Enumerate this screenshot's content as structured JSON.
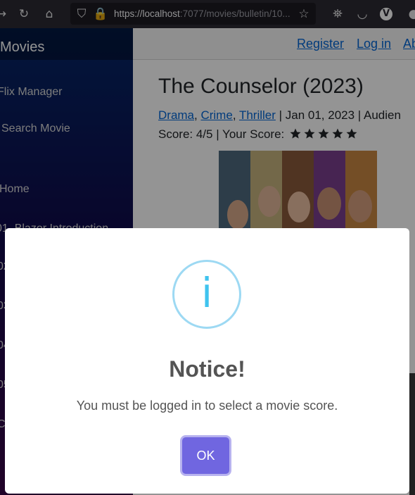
{
  "browser": {
    "url_main": "https://localhost",
    "url_rest": ":7077/movies/bulletin/10..."
  },
  "sidebar": {
    "brand": "Movies",
    "items": [
      {
        "label": "Flix Manager"
      },
      {
        "label": "Search Movie"
      },
      {
        "label": "Home"
      },
      {
        "label": "01. Blazor Introduction"
      },
      {
        "label": "02"
      },
      {
        "label": "03"
      },
      {
        "label": "04"
      },
      {
        "label": "05"
      },
      {
        "label": "C"
      }
    ]
  },
  "topbar": {
    "register": "Register",
    "login": "Log in",
    "about": "Ab"
  },
  "movie": {
    "title": "The Counselor (2023)",
    "genres": [
      "Drama",
      "Crime",
      "Thriller"
    ],
    "date_text": " | Jan 01, 2023 | Audien",
    "score_text": "Score: 4/5 | Your Score:",
    "your_score_stars": 5
  },
  "modal": {
    "icon": "info-icon",
    "title": "Notice!",
    "message": "You must be logged in to select a movie score.",
    "ok_label": "OK",
    "accent_color": "#7066e0",
    "icon_color": "#3fc3ee"
  }
}
